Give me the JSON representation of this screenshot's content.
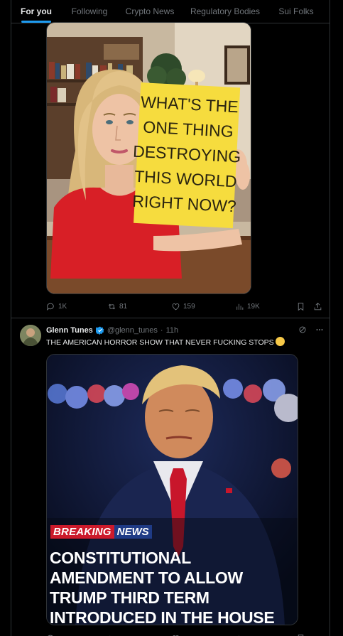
{
  "tabs": [
    {
      "label": "For you"
    },
    {
      "label": "Following"
    },
    {
      "label": "Crypto News"
    },
    {
      "label": "Regulatory Bodies"
    },
    {
      "label": "Sui Folks"
    }
  ],
  "post1": {
    "sign_lines": [
      "WHAT'S THE",
      "ONE THING",
      "DESTROYING",
      "THIS WORLD",
      "RIGHT NOW?"
    ],
    "stats": {
      "replies": "1K",
      "reposts": "81",
      "likes": "159",
      "views": "19K"
    }
  },
  "post2": {
    "author_name": "Glenn Tunes",
    "handle": "@glenn_tunes",
    "separator": "·",
    "time": "11h",
    "text": "THE AMERICAN HORROR SHOW THAT NEVER FUCKING STOPS",
    "breaking": "BREAKING",
    "news": "NEWS",
    "headline_lines": [
      "CONSTITUTIONAL",
      "AMENDMENT TO ALLOW",
      "TRUMP THIRD TERM",
      "INTRODUCED IN THE HOUSE"
    ]
  },
  "colors": {
    "accent": "#1d9bf0",
    "muted": "#71767b",
    "background": "#000000",
    "breaking_red": "#cc1a2b",
    "news_blue": "#1f3b86",
    "sign_yellow": "#f6dc3e"
  },
  "icons": [
    "reply-icon",
    "repost-icon",
    "like-icon",
    "views-icon",
    "bookmark-icon",
    "share-icon",
    "verified-icon",
    "grok-icon",
    "more-icon"
  ]
}
